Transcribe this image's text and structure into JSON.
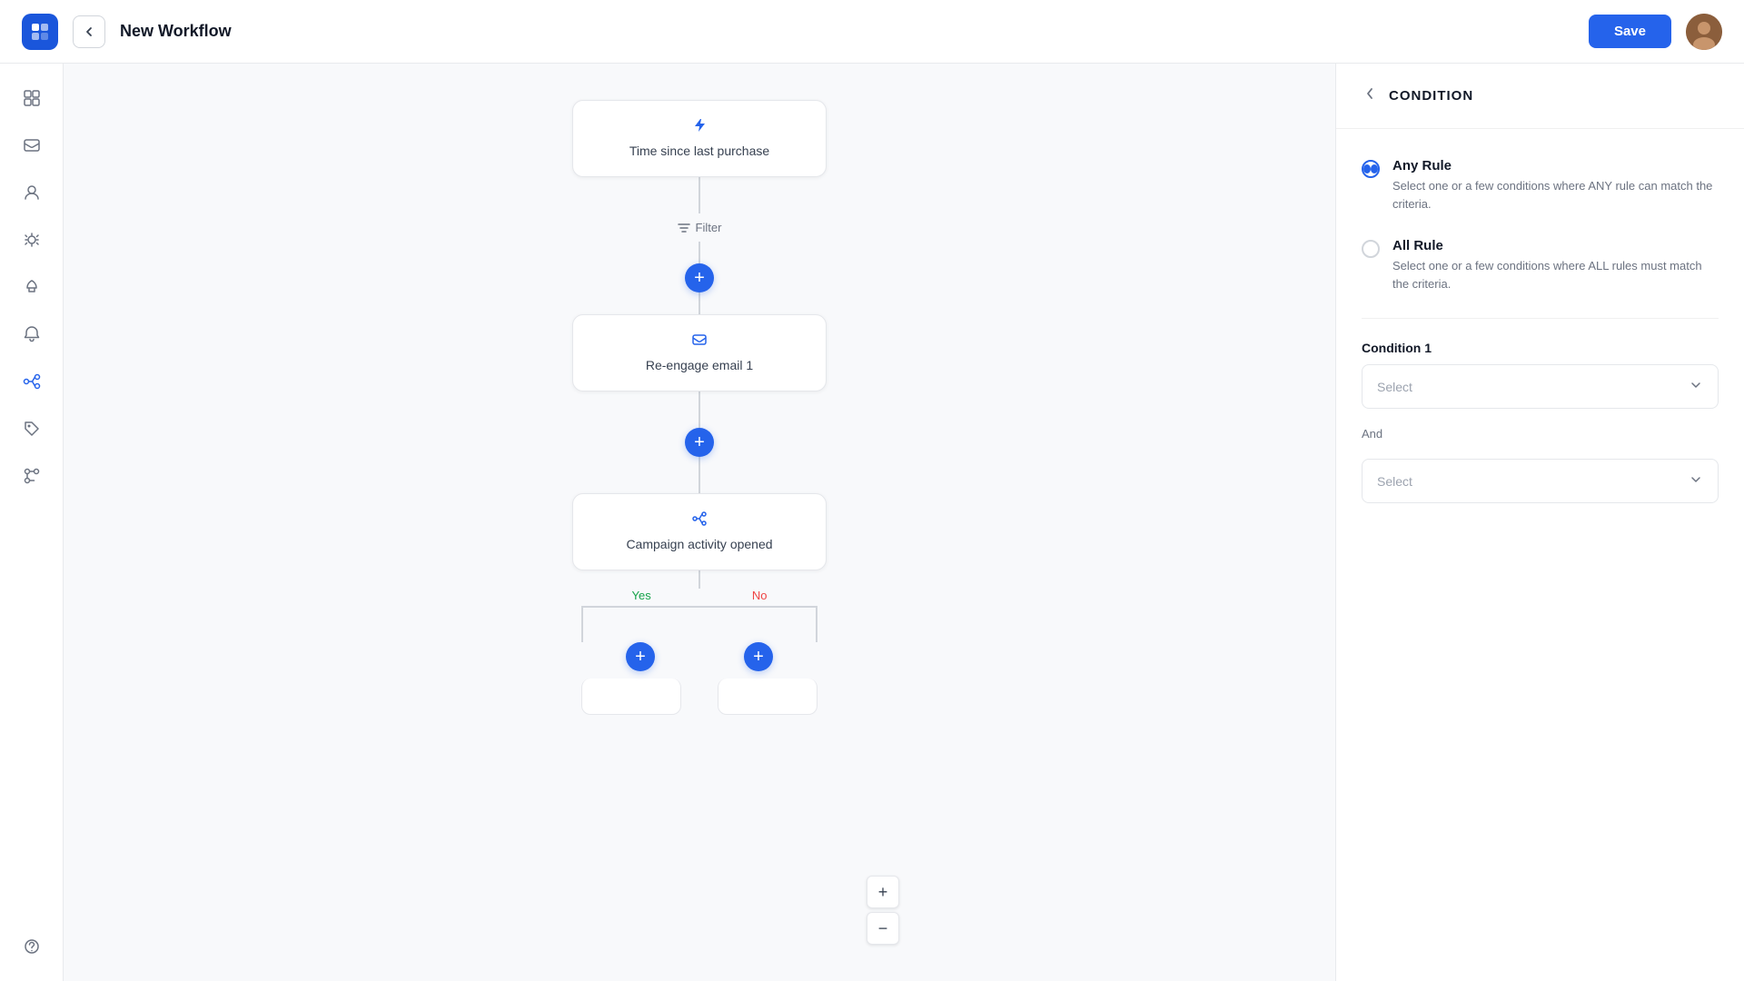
{
  "header": {
    "title": "New Workflow",
    "save_label": "Save",
    "back_label": "←"
  },
  "sidebar": {
    "items": [
      {
        "name": "dashboard",
        "icon": "⊞",
        "active": false
      },
      {
        "name": "contacts",
        "icon": "✉",
        "active": false
      },
      {
        "name": "profile",
        "icon": "👤",
        "active": false
      },
      {
        "name": "campaigns",
        "icon": "📣",
        "active": false
      },
      {
        "name": "launches",
        "icon": "🚀",
        "active": false
      },
      {
        "name": "notifications",
        "icon": "🔔",
        "active": false
      },
      {
        "name": "workflows",
        "icon": "⑂",
        "active": true
      },
      {
        "name": "tags",
        "icon": "🏷",
        "active": false
      },
      {
        "name": "integrations",
        "icon": "🔗",
        "active": false
      }
    ]
  },
  "workflow": {
    "nodes": [
      {
        "id": "node1",
        "label": "Time since last purchase",
        "icon": "⚡",
        "icon_class": "node-icon-bolt"
      },
      {
        "id": "node2",
        "label": "Re-engage email 1",
        "icon": "✉",
        "icon_class": "node-icon-mail"
      },
      {
        "id": "node3",
        "label": "Campaign activity opened",
        "icon": "⑂",
        "icon_class": "node-icon-branch"
      }
    ],
    "filter_label": "Filter",
    "branch_yes": "Yes",
    "branch_no": "No"
  },
  "right_panel": {
    "title": "CONDITION",
    "back_label": "←",
    "any_rule": {
      "label": "Any Rule",
      "description": "Select one or a few conditions where ANY rule can match the criteria."
    },
    "all_rule": {
      "label": "All Rule",
      "description": "Select one or a few conditions where ALL rules must match the criteria."
    },
    "condition1_label": "Condition 1",
    "condition1_placeholder": "Select",
    "and_label": "And",
    "condition2_placeholder": "Select"
  },
  "zoom": {
    "plus": "+",
    "minus": "−"
  }
}
